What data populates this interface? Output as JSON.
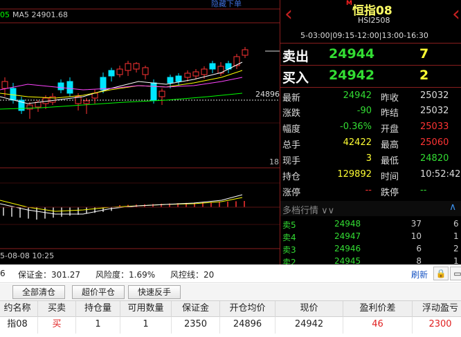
{
  "chart": {
    "legend_left": "05",
    "legend_ma5": "MA5 24901.68",
    "hide_link": "隐藏下单",
    "price_tag": "24896",
    "scale_label": "18",
    "time_label": "5-08-08 10:25",
    "colors": {
      "up": "#ff3333",
      "down": "#00e5ff",
      "ma5": "#ffffff",
      "ma10": "#ffff00",
      "ma20": "#ff44ff",
      "ma60": "#00ff00"
    }
  },
  "header": {
    "m_badge": "M",
    "name": "恒指08",
    "code": "HSI2508",
    "sessions": "5-03:00|09:15-12:00|13:00-16:30"
  },
  "book": {
    "sell_label": "卖出",
    "sell_price": "24944",
    "sell_qty": "7",
    "buy_label": "买入",
    "buy_price": "24942",
    "buy_qty": "2"
  },
  "stats": [
    {
      "l1": "最新",
      "v1": "24942",
      "c1": "green",
      "l2": "昨收",
      "v2": "25032",
      "c2": "white"
    },
    {
      "l1": "涨跌",
      "v1": "-90",
      "c1": "green",
      "l2": "昨结",
      "v2": "25032",
      "c2": "white"
    },
    {
      "l1": "幅度",
      "v1": "-0.36%",
      "c1": "green",
      "l2": "开盘",
      "v2": "25033",
      "c2": "red"
    },
    {
      "l1": "总手",
      "v1": "42422",
      "c1": "yellow",
      "l2": "最高",
      "v2": "25060",
      "c2": "red"
    },
    {
      "l1": "现手",
      "v1": "3",
      "c1": "yellow",
      "l2": "最低",
      "v2": "24820",
      "c2": "green"
    },
    {
      "l1": "持仓",
      "v1": "129892",
      "c1": "yellow",
      "l2": "时间",
      "v2": "10:52:42",
      "c2": "white"
    },
    {
      "l1": "涨停",
      "v1": "--",
      "c1": "red",
      "l2": "跌停",
      "v2": "--",
      "c2": "green"
    }
  ],
  "depth": {
    "title": "多档行情 ∨∨",
    "rows": [
      {
        "label": "卖5",
        "price": "24948",
        "qty": "37",
        "extra": "6"
      },
      {
        "label": "卖4",
        "price": "24947",
        "qty": "10",
        "extra": "1"
      },
      {
        "label": "卖3",
        "price": "24946",
        "qty": "6",
        "extra": "2"
      },
      {
        "label": "卖2",
        "price": "24945",
        "qty": "8",
        "extra": "1"
      }
    ]
  },
  "status": {
    "left_num": "6",
    "margin": "保证金：301.27",
    "risk": "风险度：1.69%",
    "control": "风控线：20",
    "refresh": "刷新"
  },
  "toolbar": {
    "close_all": "全部清仓",
    "super_close": "超价平仓",
    "fast_reverse": "快速反手"
  },
  "positions": {
    "columns": [
      "约名称",
      "买卖",
      "持仓量",
      "可用数量",
      "保证金",
      "开仓均价",
      "现价",
      "盈利价差",
      "浮动盈亏"
    ],
    "rows": [
      [
        "指08",
        "买",
        "1",
        "1",
        "2350",
        "24896",
        "24942",
        "46",
        "2300"
      ]
    ]
  }
}
